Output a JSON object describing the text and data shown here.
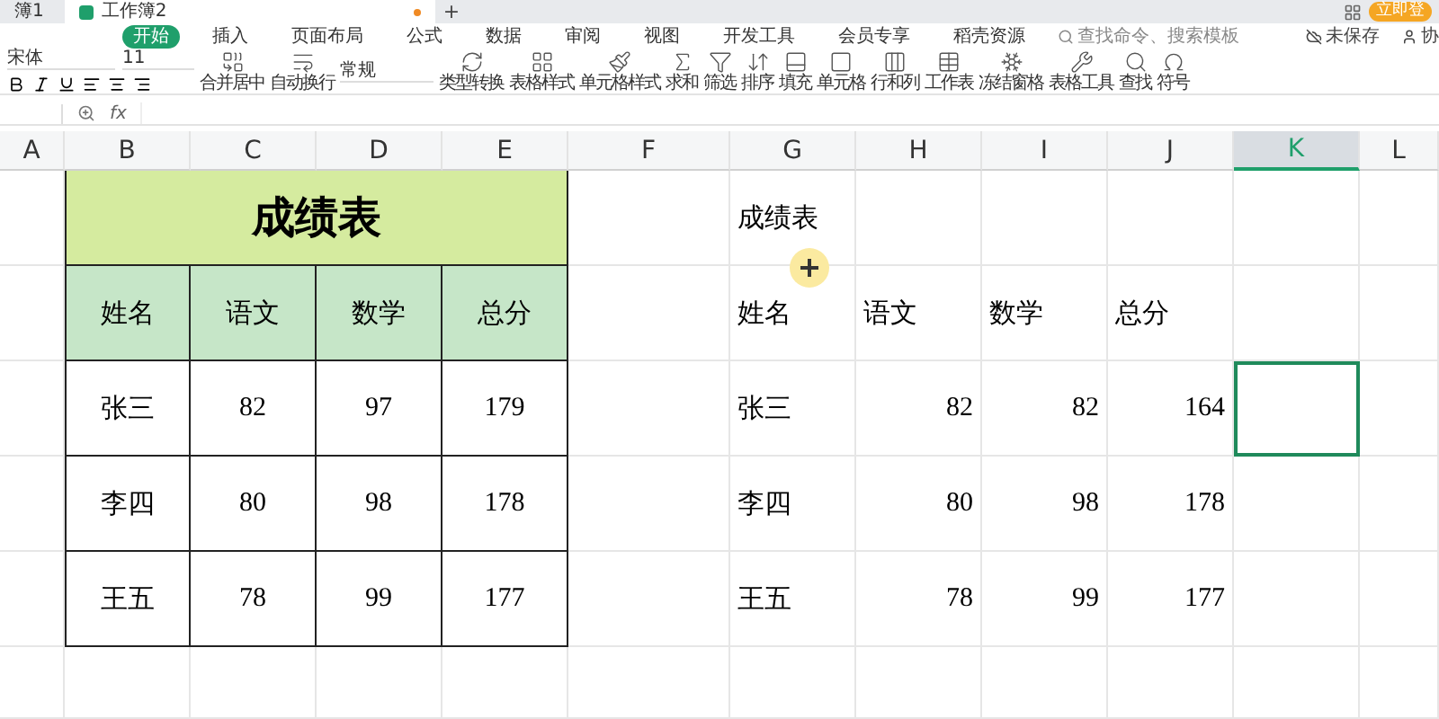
{
  "tabs": [
    {
      "label": "簿1",
      "selected": false
    },
    {
      "label": "工作簿2",
      "selected": true
    }
  ],
  "new_tab": "+",
  "account_button": "立即登",
  "menu": [
    {
      "label": "开始",
      "selected": true
    },
    {
      "label": "插入",
      "selected": false
    },
    {
      "label": "页面布局",
      "selected": false
    },
    {
      "label": "公式",
      "selected": false
    },
    {
      "label": "数据",
      "selected": false
    },
    {
      "label": "审阅",
      "selected": false
    },
    {
      "label": "视图",
      "selected": false
    },
    {
      "label": "开发工具",
      "selected": false
    },
    {
      "label": "会员专享",
      "selected": false
    },
    {
      "label": "稻壳资源",
      "selected": false
    }
  ],
  "search": {
    "placeholder": "查找命令、搜索模板"
  },
  "save_status": "未保存",
  "share": "协",
  "font": {
    "name": "宋体",
    "size": "11"
  },
  "number_format": "常规",
  "ribbon": [
    {
      "label": "合并居中"
    },
    {
      "label": "自动换行"
    },
    {
      "label": "类型转换"
    },
    {
      "label": "表格样式"
    },
    {
      "label": "单元格样式"
    },
    {
      "label": "求和"
    },
    {
      "label": "筛选"
    },
    {
      "label": "排序"
    },
    {
      "label": "填充"
    },
    {
      "label": "单元格"
    },
    {
      "label": "行和列"
    },
    {
      "label": "工作表"
    },
    {
      "label": "冻结窗格"
    },
    {
      "label": "表格工具"
    },
    {
      "label": "查找"
    },
    {
      "label": "符号"
    }
  ],
  "formula_bar": {
    "fx": "fx"
  },
  "columns": [
    {
      "letter": "A",
      "selected": false
    },
    {
      "letter": "B",
      "selected": false
    },
    {
      "letter": "C",
      "selected": false
    },
    {
      "letter": "D",
      "selected": false
    },
    {
      "letter": "E",
      "selected": false
    },
    {
      "letter": "F",
      "selected": false
    },
    {
      "letter": "G",
      "selected": false
    },
    {
      "letter": "H",
      "selected": false
    },
    {
      "letter": "I",
      "selected": false
    },
    {
      "letter": "J",
      "selected": false
    },
    {
      "letter": "K",
      "selected": true
    },
    {
      "letter": "L",
      "selected": false
    }
  ],
  "left_table": {
    "title": "成绩表",
    "headers": [
      "姓名",
      "语文",
      "数学",
      "总分"
    ],
    "rows": [
      [
        "张三",
        "82",
        "97",
        "179"
      ],
      [
        "李四",
        "80",
        "98",
        "178"
      ],
      [
        "王五",
        "78",
        "99",
        "177"
      ]
    ]
  },
  "right_table": {
    "title": "成绩表",
    "headers": [
      "姓名",
      "语文",
      "数学",
      "总分"
    ],
    "rows": [
      {
        "cells": [
          "张三",
          "82",
          "82",
          "164"
        ],
        "selected": true
      },
      {
        "cells": [
          "李四",
          "80",
          "98",
          "178"
        ],
        "selected": false
      },
      {
        "cells": [
          "王五",
          "78",
          "99",
          "177"
        ],
        "selected": false
      }
    ]
  }
}
